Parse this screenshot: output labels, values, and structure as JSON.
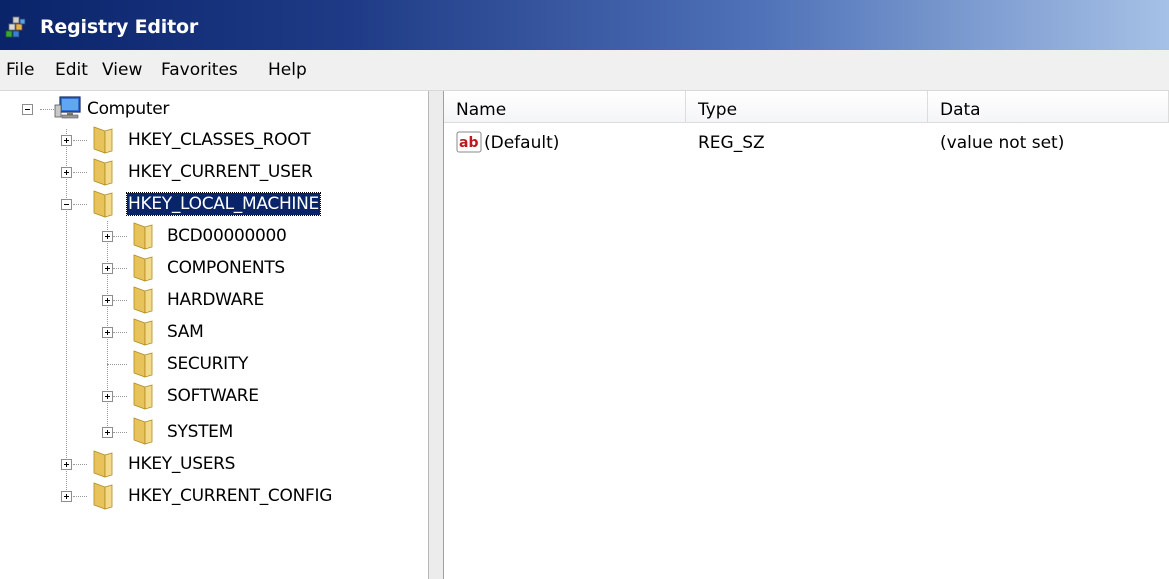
{
  "window": {
    "title": "Registry Editor",
    "icon": "regedit-icon"
  },
  "menu": [
    "File",
    "Edit",
    "View",
    "Favorites",
    "Help"
  ],
  "tree": {
    "root": "Computer",
    "hives": [
      {
        "label": "HKEY_CLASSES_ROOT",
        "expanded": false
      },
      {
        "label": "HKEY_CURRENT_USER",
        "expanded": false
      },
      {
        "label": "HKEY_LOCAL_MACHINE",
        "expanded": true,
        "selected": true
      },
      {
        "label": "HKEY_USERS",
        "expanded": false
      },
      {
        "label": "HKEY_CURRENT_CONFIG",
        "expanded": false
      }
    ],
    "hklm_children": [
      {
        "label": "BCD00000000",
        "has_children": true
      },
      {
        "label": "COMPONENTS",
        "has_children": true
      },
      {
        "label": "HARDWARE",
        "has_children": true
      },
      {
        "label": "SAM",
        "has_children": true
      },
      {
        "label": "SECURITY",
        "has_children": false
      },
      {
        "label": "SOFTWARE",
        "has_children": true
      },
      {
        "label": "SYSTEM",
        "has_children": true
      }
    ]
  },
  "list": {
    "columns": [
      "Name",
      "Type",
      "Data"
    ],
    "rows": [
      {
        "name": "(Default)",
        "type": "REG_SZ",
        "data": "(value not set)",
        "icon": "string-value-icon"
      }
    ]
  },
  "colors": {
    "selection": "#0a246a",
    "folder": "#e8c25a",
    "titlebar_start": "#0a246a",
    "titlebar_end": "#a6c1e6"
  }
}
